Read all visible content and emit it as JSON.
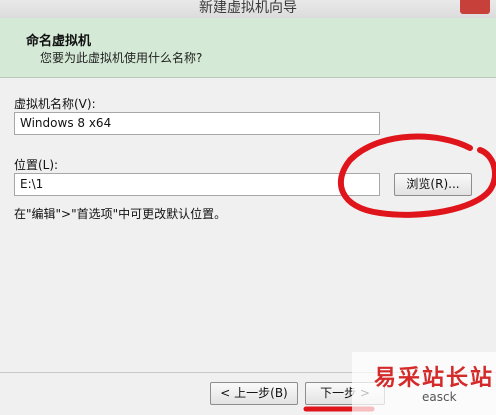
{
  "window": {
    "title": "新建虚拟机向导"
  },
  "header": {
    "title": "命名虚拟机",
    "subtitle": "您要为此虚拟机使用什么名称?"
  },
  "vm_name": {
    "label": "虚拟机名称(V):",
    "value": "Windows 8 x64"
  },
  "location": {
    "label": "位置(L):",
    "value": "E:\\1",
    "browse_label": "浏览(R)..."
  },
  "hint": "在\"编辑\">\"首选项\"中可更改默认位置。",
  "footer": {
    "back_label": "< 上一步(B)",
    "next_label": "下一步 >"
  },
  "watermark": {
    "brand": "易采站长站",
    "domain": "easck"
  },
  "colors": {
    "header_bg": "#d5ead6",
    "annotation_red": "#e0141b"
  }
}
